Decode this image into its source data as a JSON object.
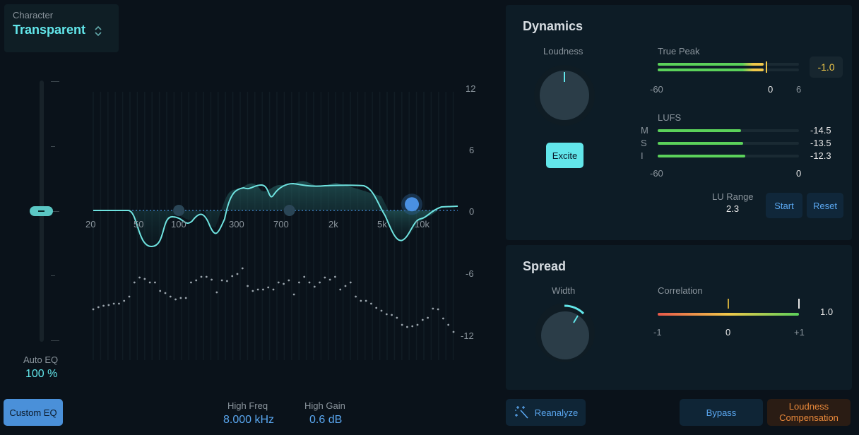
{
  "character": {
    "label": "Character",
    "value": "Transparent"
  },
  "auto_eq": {
    "label": "Auto EQ",
    "value": "100 %",
    "slider_fraction": 0.5
  },
  "custom_eq_label": "Custom EQ",
  "eq": {
    "freq_labels": [
      "20",
      "50",
      "100",
      "300",
      "700",
      "2k",
      "5k",
      "10k"
    ],
    "gain_labels": [
      "12",
      "6",
      "0",
      "-6",
      "-12"
    ],
    "nodes": [
      {
        "freq_hz": 100,
        "gain_db": 0,
        "selected": false
      },
      {
        "freq_hz": 800,
        "gain_db": 0,
        "selected": false
      },
      {
        "freq_hz": 8000,
        "gain_db": 0.6,
        "selected": true
      }
    ]
  },
  "high_freq": {
    "label": "High Freq",
    "value": "8.000 kHz"
  },
  "high_gain": {
    "label": "High Gain",
    "value": "0.6 dB"
  },
  "dynamics": {
    "title": "Dynamics",
    "loudness_label": "Loudness",
    "excite_label": "Excite",
    "true_peak": {
      "label": "True Peak",
      "value": "-1.0",
      "scale": [
        "-60",
        "0",
        "6"
      ],
      "level_db": -1.0
    },
    "lufs": {
      "label": "LUFS",
      "rows": [
        {
          "ch": "M",
          "value": "-14.5",
          "level": -14.5
        },
        {
          "ch": "S",
          "value": "-13.5",
          "level": -13.5
        },
        {
          "ch": "I",
          "value": "-12.3",
          "level": -12.3
        }
      ],
      "scale": [
        "-60",
        "0"
      ]
    },
    "lu_range": {
      "label": "LU Range",
      "value": "2.3"
    },
    "start_label": "Start",
    "reset_label": "Reset"
  },
  "spread": {
    "title": "Spread",
    "width_label": "Width",
    "correlation": {
      "label": "Correlation",
      "value": "1.0",
      "scale": [
        "-1",
        "0",
        "+1"
      ]
    }
  },
  "bottom": {
    "reanalyze_label": "Reanalyze",
    "bypass_label": "Bypass",
    "loudness_comp_line1": "Loudness",
    "loudness_comp_line2": "Compensation"
  },
  "colors": {
    "accent": "#62e6ea",
    "blue": "#4a90d9",
    "meter_green": "#5bd15a",
    "peak_yellow": "#f0c84a",
    "orange": "#e8883a"
  }
}
